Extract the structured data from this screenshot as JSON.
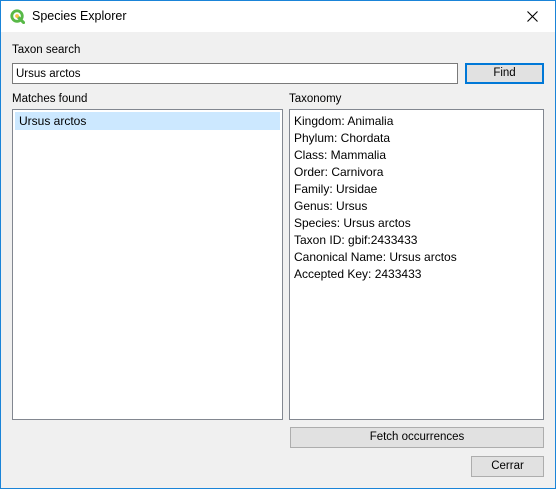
{
  "window": {
    "title": "Species Explorer"
  },
  "search": {
    "label": "Taxon search",
    "value": "Ursus arctos",
    "find_label": "Find"
  },
  "matches": {
    "label": "Matches found",
    "items": [
      "Ursus arctos"
    ],
    "selected_index": 0
  },
  "taxonomy": {
    "label": "Taxonomy",
    "lines": [
      "Kingdom: Animalia",
      "Phylum: Chordata",
      "Class: Mammalia",
      "Order: Carnivora",
      "Family: Ursidae",
      "Genus: Ursus",
      "Species: Ursus arctos",
      "Taxon ID: gbif:2433433",
      "Canonical Name: Ursus arctos",
      "Accepted Key: 2433433"
    ]
  },
  "actions": {
    "fetch_label": "Fetch occurrences",
    "close_label": "Cerrar"
  },
  "colors": {
    "accent": "#0078d7",
    "selection": "#cce8ff",
    "qgis_green": "#58b947"
  },
  "icons": {
    "app": "qgis-icon",
    "close": "close-icon"
  }
}
